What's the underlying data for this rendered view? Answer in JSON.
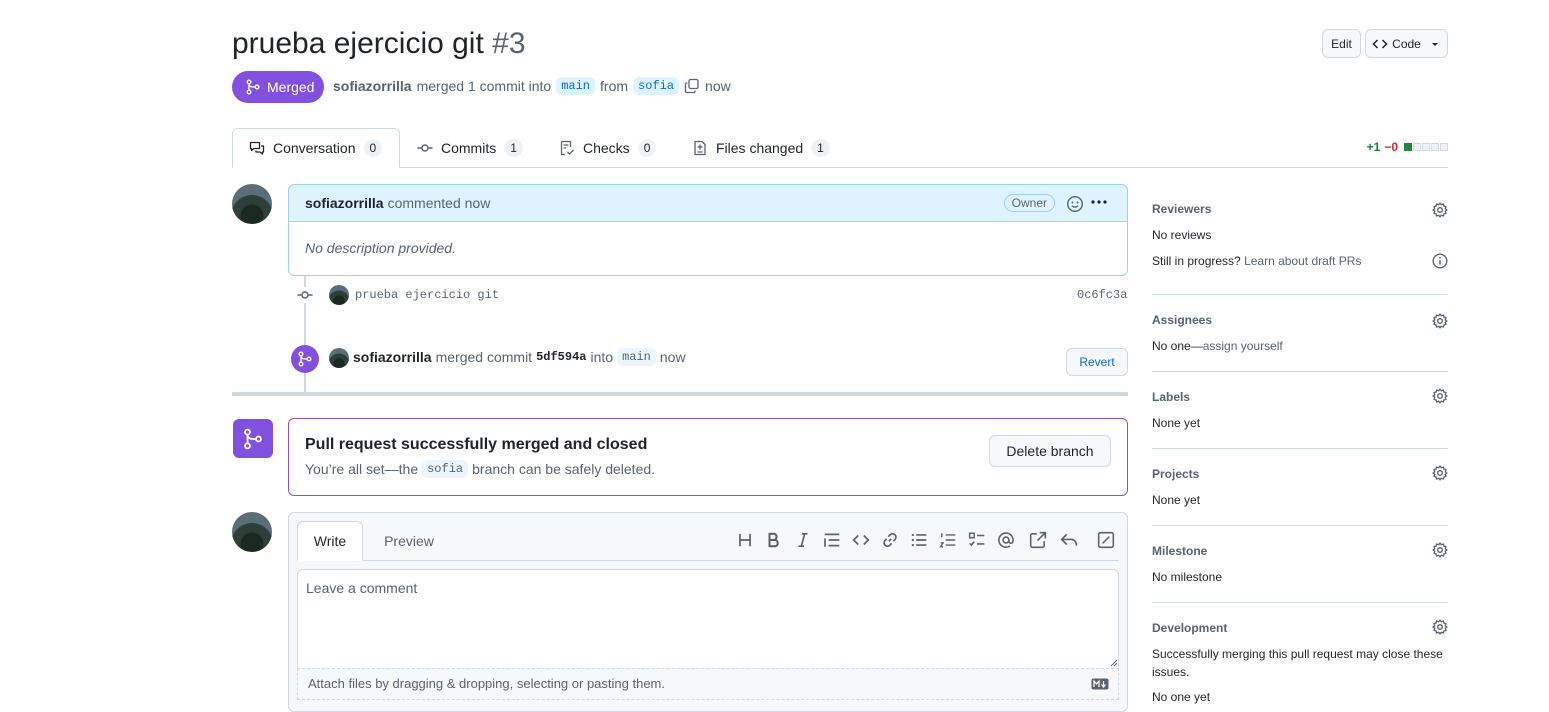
{
  "pr": {
    "title": "prueba ejercicio git",
    "number": "#3",
    "status": "Merged",
    "author": "sofiazorrilla",
    "merge_text": "merged 1 commit into",
    "base_branch": "main",
    "from_text": "from",
    "head_branch": "sofia",
    "time": "now"
  },
  "header": {
    "edit_label": "Edit",
    "code_label": "Code"
  },
  "tabs": [
    {
      "label": "Conversation",
      "count": "0"
    },
    {
      "label": "Commits",
      "count": "1"
    },
    {
      "label": "Checks",
      "count": "0"
    },
    {
      "label": "Files changed",
      "count": "1"
    }
  ],
  "diffstat": {
    "additions": "+1",
    "deletions": "−0",
    "fill": 0.2
  },
  "comment": {
    "author": "sofiazorrilla",
    "action": "commented now",
    "badge": "Owner",
    "body": "No description provided."
  },
  "commit": {
    "message": "prueba ejercicio git",
    "sha": "0c6fc3a"
  },
  "merge_event": {
    "author": "sofiazorrilla",
    "text": "merged commit",
    "sha": "5df594a",
    "into": "into",
    "branch": "main",
    "time": "now",
    "revert_label": "Revert"
  },
  "merged_box": {
    "title": "Pull request successfully merged and closed",
    "text_before": "You’re all set—the",
    "branch": "sofia",
    "text_after": "branch can be safely deleted.",
    "button": "Delete branch"
  },
  "composer": {
    "write_tab": "Write",
    "preview_tab": "Preview",
    "placeholder": "Leave a comment",
    "attach_text": "Attach files by dragging & dropping, selecting or pasting them."
  },
  "sidebar": {
    "reviewers": {
      "title": "Reviewers",
      "value": "No reviews",
      "in_progress": "Still in progress?",
      "link": "Learn about draft PRs"
    },
    "assignees": {
      "title": "Assignees",
      "value": "No one—",
      "link": "assign yourself"
    },
    "labels": {
      "title": "Labels",
      "value": "None yet"
    },
    "projects": {
      "title": "Projects",
      "value": "None yet"
    },
    "milestone": {
      "title": "Milestone",
      "value": "No milestone"
    },
    "development": {
      "title": "Development",
      "line1": "Successfully merging this pull request may close these",
      "line2": "issues.",
      "line3": "No one yet"
    }
  },
  "colors": {
    "merged": "#8250df",
    "link": "#0969da",
    "add": "#1a7f37",
    "del": "#d1242f"
  }
}
